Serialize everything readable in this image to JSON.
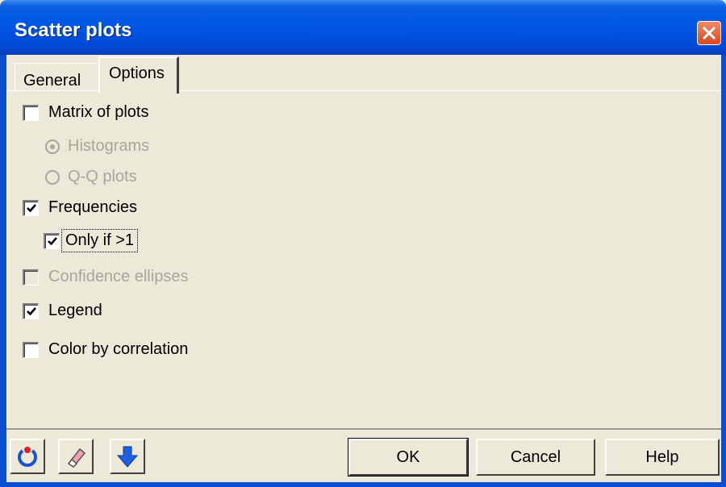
{
  "window": {
    "title": "Scatter plots"
  },
  "tabs": [
    {
      "label": "General",
      "active": false
    },
    {
      "label": "Options",
      "active": true
    }
  ],
  "options": {
    "matrix_of_plots": {
      "label": "Matrix of plots",
      "checked": false,
      "enabled": true
    },
    "histograms": {
      "label": "Histograms",
      "selected": true,
      "enabled": false
    },
    "qq_plots": {
      "label": "Q-Q plots",
      "selected": false,
      "enabled": false
    },
    "frequencies": {
      "label": "Frequencies",
      "checked": true,
      "enabled": true
    },
    "only_if_gt1": {
      "label": "Only if >1",
      "checked": true,
      "enabled": true
    },
    "confidence_ellipses": {
      "label": "Confidence ellipses",
      "checked": false,
      "enabled": false
    },
    "legend": {
      "label": "Legend",
      "checked": true,
      "enabled": true
    },
    "color_by_correlation": {
      "label": "Color by correlation",
      "checked": false,
      "enabled": true
    }
  },
  "footer": {
    "icons": [
      "reset-icon",
      "eraser-icon",
      "down-arrow-icon"
    ],
    "ok_label": "OK",
    "cancel_label": "Cancel",
    "help_label": "Help"
  }
}
